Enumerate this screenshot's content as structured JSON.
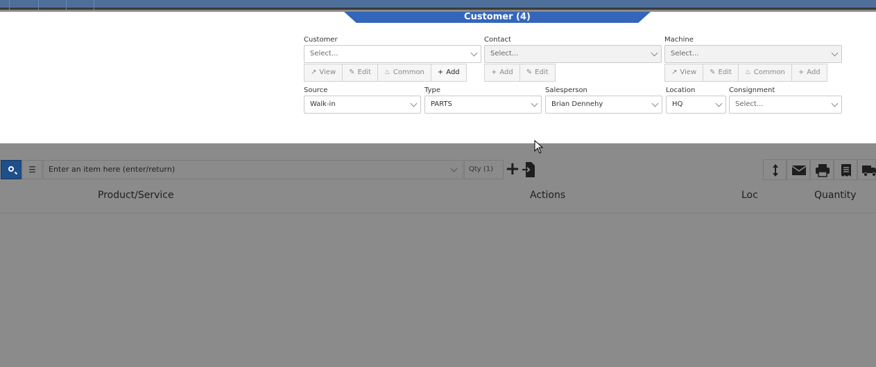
{
  "panel": {
    "title": "Customer (4)",
    "customer": {
      "label": "Customer",
      "placeholder": "Select...",
      "buttons": [
        {
          "icon": "external-link-icon",
          "label": "View"
        },
        {
          "icon": "pencil-icon",
          "label": "Edit"
        },
        {
          "icon": "fire-icon",
          "label": "Common"
        },
        {
          "icon": "plus-icon",
          "label": "Add"
        }
      ]
    },
    "contact": {
      "label": "Contact",
      "placeholder": "Select...",
      "buttons": [
        {
          "icon": "plus-icon",
          "label": "Add"
        },
        {
          "icon": "pencil-icon",
          "label": "Edit"
        }
      ]
    },
    "machine": {
      "label": "Machine",
      "placeholder": "Select...",
      "buttons": [
        {
          "icon": "external-link-icon",
          "label": "View"
        },
        {
          "icon": "pencil-icon",
          "label": "Edit"
        },
        {
          "icon": "fire-icon",
          "label": "Common"
        },
        {
          "icon": "plus-icon",
          "label": "Add"
        }
      ]
    },
    "source": {
      "label": "Source",
      "value": "Walk-in"
    },
    "type": {
      "label": "Type",
      "value": "PARTS"
    },
    "salesperson": {
      "label": "Salesperson",
      "value": "Brian Dennehy"
    },
    "location": {
      "label": "Location",
      "value": "HQ"
    },
    "consignment": {
      "label": "Consignment",
      "placeholder": "Select..."
    }
  },
  "itembar": {
    "item_placeholder": "Enter an item here (enter/return)",
    "qty_placeholder": "Qty (1)",
    "add_glyph": "+",
    "scan_glyph": "☰"
  },
  "toolbar_icons": [
    "resize-vertical-icon",
    "envelope-icon",
    "print-icon",
    "receipt-icon",
    "truck-icon"
  ],
  "table": {
    "columns": [
      "Product/Service",
      "Actions",
      "Loc",
      "Quantity"
    ]
  },
  "colors": {
    "topbar": "#4d6f99",
    "tab": "#3366bb",
    "overlay": "#8b8b8b",
    "search_button": "#1f4f8a"
  }
}
